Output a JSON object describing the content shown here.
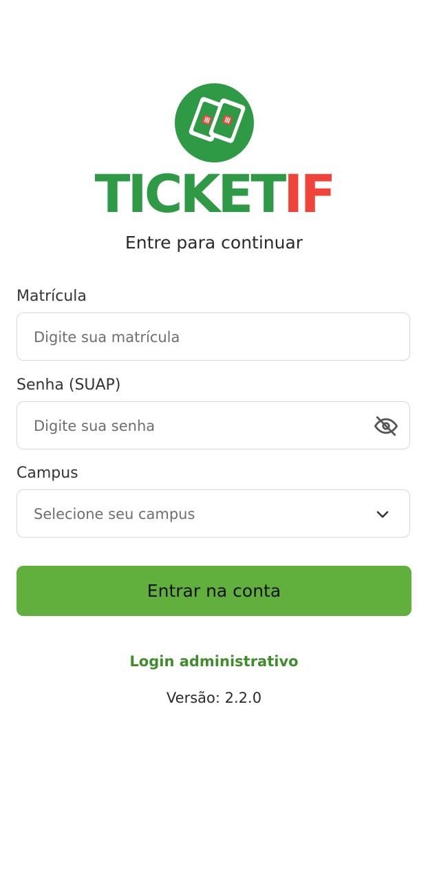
{
  "logo": {
    "icon": "ticket-restaurant-icon",
    "brand_part1": "TICKET",
    "brand_part2": "IF",
    "colors": {
      "green": "#2e9a45",
      "red": "#f0443a"
    }
  },
  "subtitle": "Entre para continuar",
  "form": {
    "matricula": {
      "label": "Matrícula",
      "placeholder": "Digite sua matrícula",
      "value": ""
    },
    "senha": {
      "label": "Senha (SUAP)",
      "placeholder": "Digite sua senha",
      "value": "",
      "toggle_icon": "eye-off-icon"
    },
    "campus": {
      "label": "Campus",
      "placeholder": "Selecione seu campus",
      "value": "",
      "dropdown_icon": "chevron-down-icon"
    }
  },
  "submit_button": {
    "label": "Entrar na conta",
    "color": "#61b03e"
  },
  "admin_link": {
    "label": "Login administrativo",
    "color": "#3f8d2b"
  },
  "version": "Versão: 2.2.0"
}
